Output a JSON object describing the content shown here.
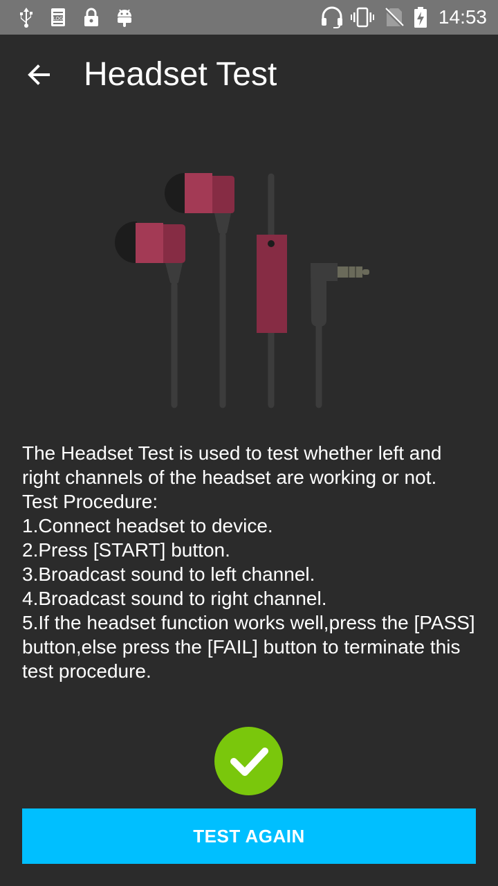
{
  "status_bar": {
    "time": "14:53",
    "left_icons": [
      "usb-icon",
      "log-icon",
      "lock-icon",
      "android-icon"
    ],
    "right_icons": [
      "headset-icon",
      "vibrate-icon",
      "no-sim-icon",
      "battery-charging-icon"
    ]
  },
  "app_bar": {
    "title": "Headset Test",
    "back_icon": "arrow-left-icon"
  },
  "illustration": {
    "name": "earphones-illustration",
    "colors": {
      "bud": "#a33a55",
      "bud_dark": "#862c44",
      "tip": "#1c1c1c",
      "cable": "#3c3c3c",
      "plug": "#6a6a5a"
    }
  },
  "description": {
    "lines": [
      "The Headset Test is used to test whether left and right channels of the headset are working or not.",
      "Test Procedure:",
      "1.Connect headset to device.",
      "2.Press [START] button.",
      "3.Broadcast sound to left channel.",
      "4.Broadcast sound to right channel.",
      "5.If the headset function works well,press the [PASS] button,else press the [FAIL] button to terminate this test procedure."
    ]
  },
  "result": {
    "icon": "checkmark-icon",
    "color": "#7ac70c"
  },
  "action_button": {
    "label": "TEST AGAIN",
    "color": "#00bfff"
  }
}
